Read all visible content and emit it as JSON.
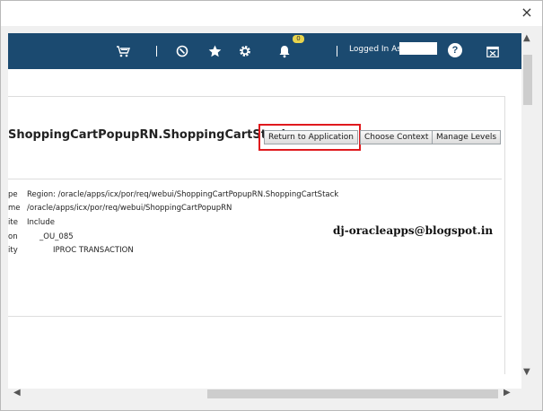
{
  "window": {
    "close_glyph": "×"
  },
  "header": {
    "notification_count": "0",
    "logged_in_label": "Logged In As",
    "help_glyph": "?"
  },
  "page": {
    "title": "ShoppingCartPopupRN.ShoppingCartStack",
    "buttons": {
      "return_to_application": "Return to Application",
      "choose_context": "Choose Context",
      "manage_levels": "Manage Levels"
    },
    "rows": [
      {
        "label": "pe",
        "value": "Region: /oracle/apps/icx/por/req/webui/ShoppingCartPopupRN.ShoppingCartStack"
      },
      {
        "label": "me",
        "value": "/oracle/apps/icx/por/req/webui/ShoppingCartPopupRN"
      },
      {
        "label": "ite",
        "value": "Include"
      },
      {
        "label": "on",
        "value": "_OU_085"
      },
      {
        "label": "ity",
        "value": "IPROC TRANSACTION"
      }
    ]
  },
  "watermark": "dj-oracleapps@blogspot.in",
  "colors": {
    "header_bg": "#1b4a70",
    "highlight": "#e0191d",
    "badge": "#e8d44d"
  }
}
